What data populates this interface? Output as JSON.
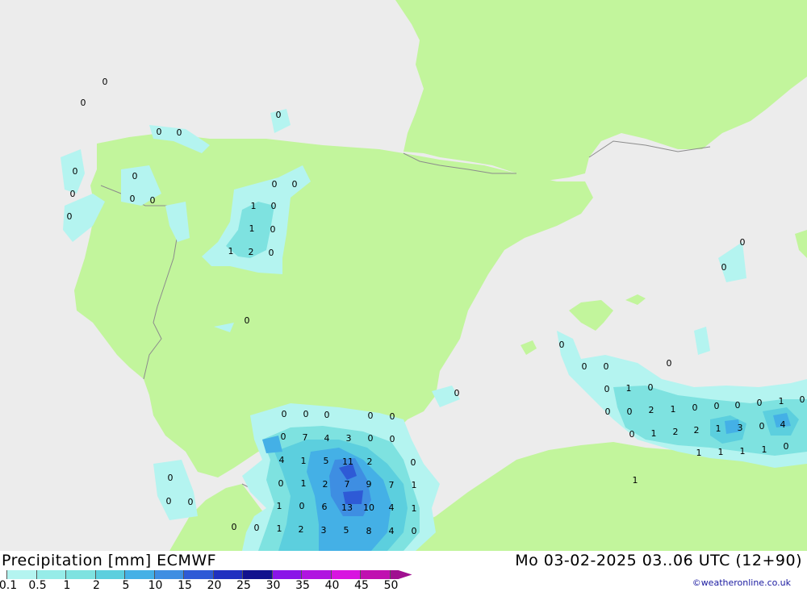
{
  "header": {
    "title": "Precipitation [mm] ECMWF",
    "datetime": "Mo 03-02-2025 03..06 UTC (12+90)",
    "credit": "©weatheronline.co.uk"
  },
  "colors": {
    "sea": "#ececec",
    "land": "#c2f59c",
    "border": "#8c8c8c"
  },
  "legend": {
    "items": [
      {
        "label": "0.1",
        "color": "#b4f4f0"
      },
      {
        "label": "0.5",
        "color": "#96ece8"
      },
      {
        "label": "1",
        "color": "#7ee2e0"
      },
      {
        "label": "2",
        "color": "#5ccfde"
      },
      {
        "label": "5",
        "color": "#44b0e6"
      },
      {
        "label": "10",
        "color": "#3e8ee2"
      },
      {
        "label": "15",
        "color": "#2e5ad6"
      },
      {
        "label": "20",
        "color": "#2030c0"
      },
      {
        "label": "25",
        "color": "#12128e"
      },
      {
        "label": "30",
        "color": "#8a14e8"
      },
      {
        "label": "35",
        "color": "#b014e0"
      },
      {
        "label": "40",
        "color": "#d814e0"
      },
      {
        "label": "45",
        "color": "#c010b0"
      },
      {
        "label": "50",
        "color": "#a01090"
      }
    ]
  },
  "map_labels": [
    "0",
    "0",
    "0",
    "0",
    "0",
    "0",
    "0",
    "0",
    "0",
    "0",
    "0",
    "0",
    "0",
    "1",
    "0",
    "1",
    "0",
    "1",
    "2",
    "0",
    "0",
    "0",
    "0",
    "0",
    "0",
    "0",
    "0",
    "0",
    "7",
    "4",
    "3",
    "0",
    "0",
    "4",
    "1",
    "5",
    "11",
    "2",
    "0",
    "0",
    "1",
    "2",
    "7",
    "9",
    "7",
    "1",
    "1",
    "0",
    "6",
    "13",
    "10",
    "4",
    "1",
    "0",
    "0",
    "1",
    "2",
    "3",
    "5",
    "8",
    "4",
    "0",
    "0",
    "0",
    "0",
    "0",
    "0",
    "0",
    "0",
    "0",
    "0",
    "0",
    "1",
    "0",
    "0",
    "0",
    "2",
    "1",
    "0",
    "0",
    "0",
    "0",
    "1",
    "0",
    "0",
    "1",
    "2",
    "2",
    "1",
    "3",
    "0",
    "4",
    "1",
    "1",
    "1",
    "1",
    "0",
    "1",
    "0"
  ]
}
